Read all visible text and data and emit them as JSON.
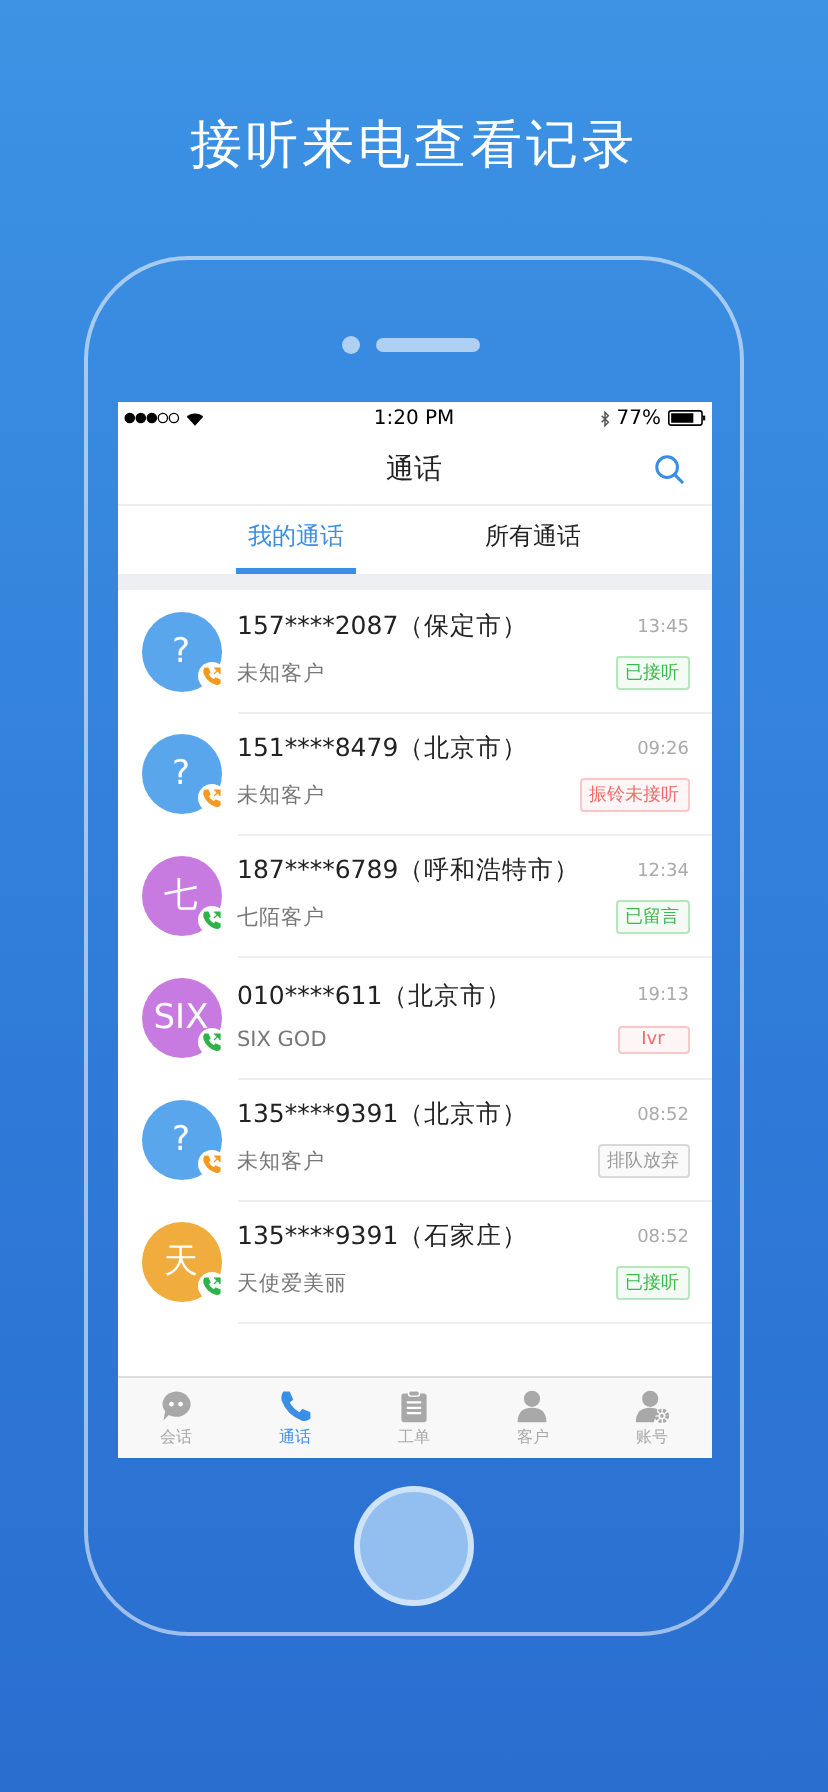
{
  "headline": "接听来电查看记录",
  "status_bar": {
    "time": "1:20 PM",
    "battery": "77%"
  },
  "nav": {
    "title": "通话"
  },
  "tabs": [
    {
      "label": "我的通话",
      "selected": true
    },
    {
      "label": "所有通话",
      "selected": false
    }
  ],
  "calls": [
    {
      "number": "157****2087（保定市）",
      "name": "未知客户",
      "time": "13:45",
      "avatar": {
        "text": "?",
        "color": "#5aa6ec"
      },
      "call_icon": {
        "color": "#f39a1e"
      },
      "status": {
        "text": "已接听",
        "color": "#3cb94c"
      }
    },
    {
      "number": "151****8479（北京市）",
      "name": "未知客户",
      "time": "09:26",
      "avatar": {
        "text": "?",
        "color": "#5aa6ec"
      },
      "call_icon": {
        "color": "#f39a1e"
      },
      "status": {
        "text": "振铃未接听",
        "color": "#f06a6a"
      }
    },
    {
      "number": "187****6789（呼和浩特市）",
      "name": "七陌客户",
      "time": "12:34",
      "avatar": {
        "text": "七",
        "color": "#c77be0"
      },
      "call_icon": {
        "color": "#2eb24a"
      },
      "status": {
        "text": "已留言",
        "color": "#3cb94c"
      }
    },
    {
      "number": "010****611（北京市）",
      "name": "SIX GOD",
      "time": "19:13",
      "avatar": {
        "text": "SIX",
        "color": "#c77be0"
      },
      "call_icon": {
        "color": "#2eb24a"
      },
      "status": {
        "text": "Ivr",
        "color": "#f06a6a"
      }
    },
    {
      "number": "135****9391（北京市）",
      "name": "未知客户",
      "time": "08:52",
      "avatar": {
        "text": "?",
        "color": "#5aa6ec"
      },
      "call_icon": {
        "color": "#f39a1e"
      },
      "status": {
        "text": "排队放弃",
        "color": "#999999"
      }
    },
    {
      "number": "135****9391（石家庄）",
      "name": "天使爱美丽",
      "time": "08:52",
      "avatar": {
        "text": "天",
        "color": "#f0ac3c"
      },
      "call_icon": {
        "color": "#2eb24a"
      },
      "status": {
        "text": "已接听",
        "color": "#3cb94c"
      }
    }
  ],
  "tab_bar": [
    {
      "kind": "chat",
      "label": "会话",
      "selected": false
    },
    {
      "kind": "phone",
      "label": "通话",
      "selected": true
    },
    {
      "kind": "clipboard",
      "label": "工单",
      "selected": false
    },
    {
      "kind": "person",
      "label": "客户",
      "selected": false
    },
    {
      "kind": "account",
      "label": "账号",
      "selected": false
    }
  ]
}
